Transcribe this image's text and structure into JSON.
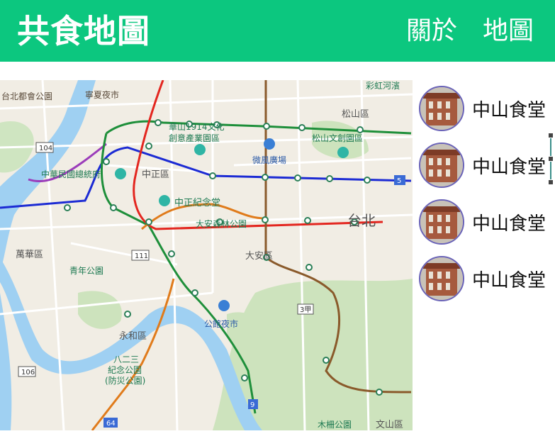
{
  "navbar": {
    "brand": "共食地圖",
    "links": [
      {
        "label": "關於"
      },
      {
        "label": "地圖"
      }
    ],
    "color": "#0cc77f"
  },
  "map": {
    "labels": {
      "taipei_park": "台北都會公園",
      "ningxia": "寧夏夜市",
      "huashan": "華山1914文化",
      "huashan2": "創意產業園區",
      "songshan": "松山區",
      "songshan_park": "松山文創園區",
      "weifeng": "微風廣場",
      "zhongzheng_district": "中正區",
      "memorial": "中華民國總統府",
      "cks": "中正紀念堂",
      "daan_park": "大安森林公園",
      "taipei": "台北",
      "wanhua": "萬華區",
      "youth_park": "青年公園",
      "daan_district": "大安區",
      "gongguan": "公館夜市",
      "yonghe": "永和區",
      "park228": "八二三",
      "park228b": "紀念公園",
      "park228c": "(防災公園)",
      "muzha": "木柵公園",
      "wenshan": "文山區",
      "rainbow": "彩虹河濱"
    },
    "route_shields": [
      "104",
      "111",
      "106",
      "64",
      "5",
      "9",
      "3甲"
    ]
  },
  "places": [
    {
      "name": "中山食堂"
    },
    {
      "name": "中山食堂"
    },
    {
      "name": "中山食堂"
    },
    {
      "name": "中山食堂"
    }
  ]
}
